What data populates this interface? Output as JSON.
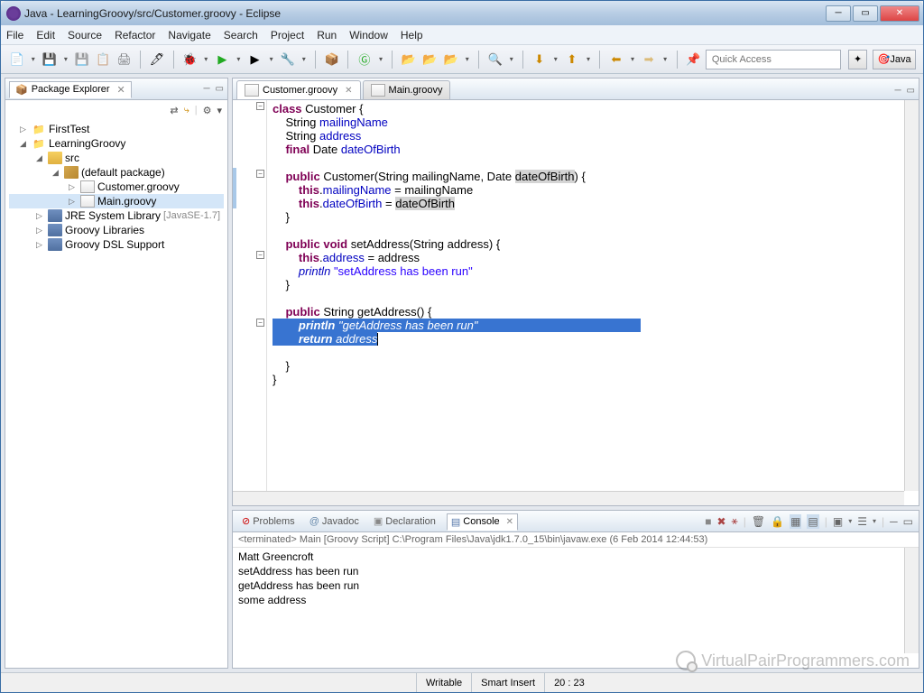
{
  "window": {
    "title": "Java - LearningGroovy/src/Customer.groovy - Eclipse"
  },
  "menu": [
    "File",
    "Edit",
    "Source",
    "Refactor",
    "Navigate",
    "Search",
    "Project",
    "Run",
    "Window",
    "Help"
  ],
  "quick_access_placeholder": "Quick Access",
  "perspective_label": "Java",
  "package_explorer": {
    "title": "Package Explorer",
    "tree": {
      "p0": "FirstTest",
      "p1": "LearningGroovy",
      "src": "src",
      "defpkg": "(default package)",
      "cust": "Customer.groovy",
      "main": "Main.groovy",
      "jre": "JRE System Library",
      "jre_ver": "[JavaSE-1.7]",
      "glib": "Groovy Libraries",
      "gdsl": "Groovy DSL Support"
    }
  },
  "editor": {
    "tabs": {
      "active": "Customer.groovy",
      "inactive": "Main.groovy"
    },
    "code": {
      "l1a": "class",
      "l1b": " Customer {",
      "l2a": "    String ",
      "l2b": "mailingName",
      "l3a": "    String ",
      "l3b": "address",
      "l4a": "    final",
      "l4b": " Date ",
      "l4c": "dateOfBirth",
      "l6a": "    public",
      "l6b": " Customer(String mailingName, Date ",
      "l6c": "dateOfBirth",
      "l6d": ") {",
      "l7a": "        this",
      "l7b": ".",
      "l7c": "mailingName",
      "l7d": " = mailingName",
      "l8a": "        this",
      "l8b": ".",
      "l8c": "dateOfBirth",
      "l8d": " = ",
      "l8e": "dateOfBirth",
      "l9": "    }",
      "l11a": "    public",
      "l11b": " void",
      "l11c": " setAddress(String address) {",
      "l12a": "        this",
      "l12b": ".",
      "l12c": "address",
      "l12d": " = address",
      "l13a": "        println",
      "l13b": " ",
      "l13c": "\"setAddress has been run\"",
      "l14": "    }",
      "l16a": "    public",
      "l16b": " String getAddress() {",
      "l17a": "        println",
      "l17b": " ",
      "l17c": "\"getAddress has been run\"",
      "l18a": "        return",
      "l18b": " ",
      "l18c": "address",
      "l20": "    }",
      "l21": "}"
    }
  },
  "bottom_tabs": {
    "problems": "Problems",
    "javadoc": "Javadoc",
    "decl": "Declaration",
    "console": "Console"
  },
  "console": {
    "header": "<terminated> Main [Groovy Script] C:\\Program Files\\Java\\jdk1.7.0_15\\bin\\javaw.exe (6 Feb 2014 12:44:53)",
    "line1": "Matt Greencroft",
    "line2": "setAddress has been run",
    "line3": "getAddress has been run",
    "line4": "some address"
  },
  "status": {
    "writable": "Writable",
    "insert": "Smart Insert",
    "pos": "20 : 23"
  },
  "watermark": "VirtualPairProgrammers.com"
}
